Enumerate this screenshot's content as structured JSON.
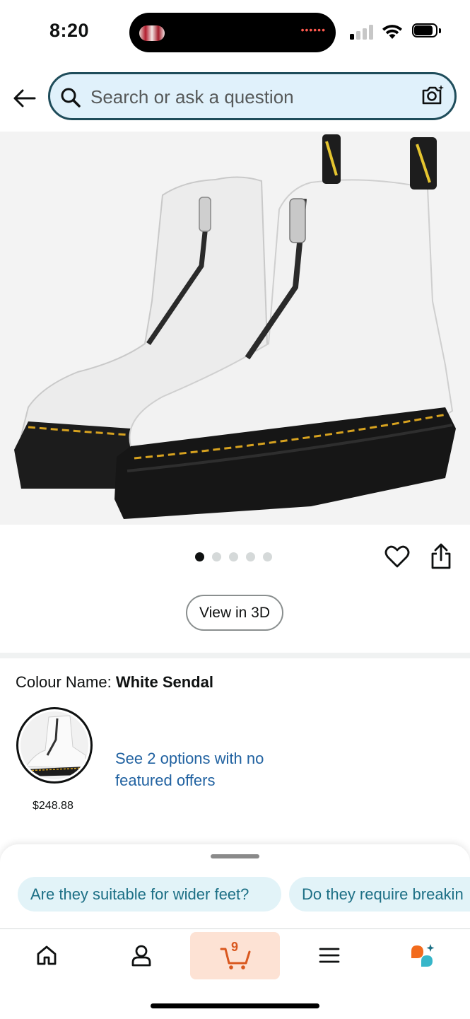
{
  "status_bar": {
    "time": "8:20",
    "signal_bars_active": 1,
    "icons": [
      "cellular-signal-icon",
      "wifi-icon",
      "battery-icon"
    ]
  },
  "header": {
    "back_icon": "arrow-left-icon",
    "search_placeholder": "Search or ask a question",
    "camera_icon": "camera-icon"
  },
  "product": {
    "image_description_icon": "product-image",
    "image_count": 5,
    "active_image_index": 0,
    "view_3d_label": "View in 3D",
    "colour_label": "Colour Name: ",
    "colour_value": "White Sendal",
    "swatch_price": "$248.88",
    "options_link": "See 2 options with no featured offers"
  },
  "assistant_sheet": {
    "suggestions": [
      "Are they suitable for wider feet?",
      "Do they require breakin"
    ]
  },
  "bottom_nav": {
    "items": [
      "home-icon",
      "account-icon",
      "cart-icon",
      "menu-icon",
      "rufus-icon"
    ],
    "cart_count": "9",
    "active_item": "cart"
  },
  "colors": {
    "search_border": "#1f4d5b",
    "search_bg": "#e0f1fb",
    "link": "#2162a1",
    "chip_bg": "#e2f3f8",
    "chip_text": "#1c6f85",
    "cart_active_bg": "#fde2d4",
    "cart_accent": "#d9581f"
  }
}
